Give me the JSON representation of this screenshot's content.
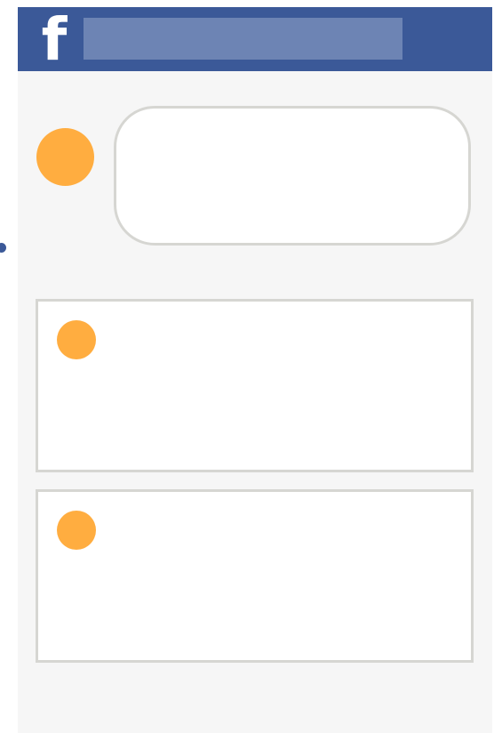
{
  "colors": {
    "brand": "#3b5998",
    "brand_light": "#6d84b4",
    "background": "#f6f6f6",
    "card": "#ffffff",
    "border": "#d6d6d2",
    "avatar": "#ffad40"
  },
  "header": {
    "logo_text": "f",
    "logo_icon": "facebook-logo-icon"
  },
  "composer": {
    "avatar_icon": "profile-avatar-icon"
  },
  "posts": [
    {
      "avatar_icon": "profile-avatar-icon"
    },
    {
      "avatar_icon": "profile-avatar-icon"
    }
  ]
}
